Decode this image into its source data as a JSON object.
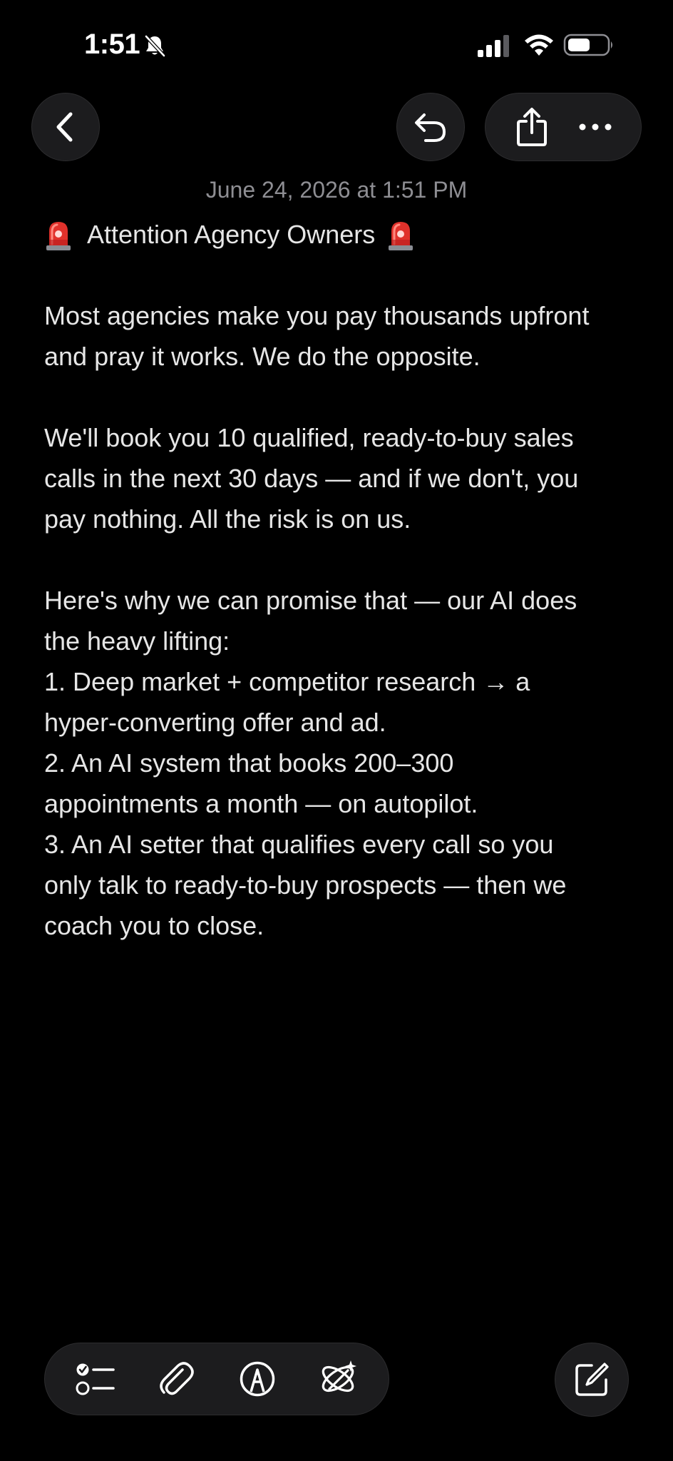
{
  "status_bar": {
    "time": "1:51",
    "icons": [
      "bell-slash-icon",
      "cellular-signal-icon",
      "wifi-icon",
      "battery-icon"
    ]
  },
  "nav": {
    "icons": [
      "chevron-left-icon",
      "undo-icon",
      "share-icon",
      "ellipsis-icon"
    ]
  },
  "note": {
    "date": "June 24, 2026 at 1:51 PM",
    "title": "Attention Agency Owners",
    "title_icon": "siren-icon",
    "paragraphs": [
      {
        "lines": [
          "Most agencies make you pay thousands upfront",
          "and pray it works. We do the opposite."
        ]
      },
      {
        "lines": [
          "We'll book you 10 qualified, ready-to-buy sales",
          "calls in the next 30 days — and if we don't, you",
          "pay nothing. All the risk is on us."
        ]
      },
      {
        "lines": [
          "Here's why we can promise that — our AI does",
          "the heavy lifting:",
          "1. Deep market + competitor research → a",
          "hyper-converting offer and ad.",
          "2. An AI system that books 200–300",
          "appointments a month — on autopilot.",
          "3. An AI setter that qualifies every call so you",
          "only talk to ready-to-buy prospects — then we",
          "coach you to close."
        ]
      }
    ]
  },
  "toolbar": {
    "icons": [
      "checklist-icon",
      "paperclip-icon",
      "markup-pen-icon",
      "apple-intelligence-icon",
      "compose-icon"
    ]
  },
  "colors": {
    "background": "#000000",
    "surface": "#1c1c1e",
    "text": "#e6e6e6",
    "secondary_text": "#8e8e93",
    "siren_red": "#e0312b"
  }
}
